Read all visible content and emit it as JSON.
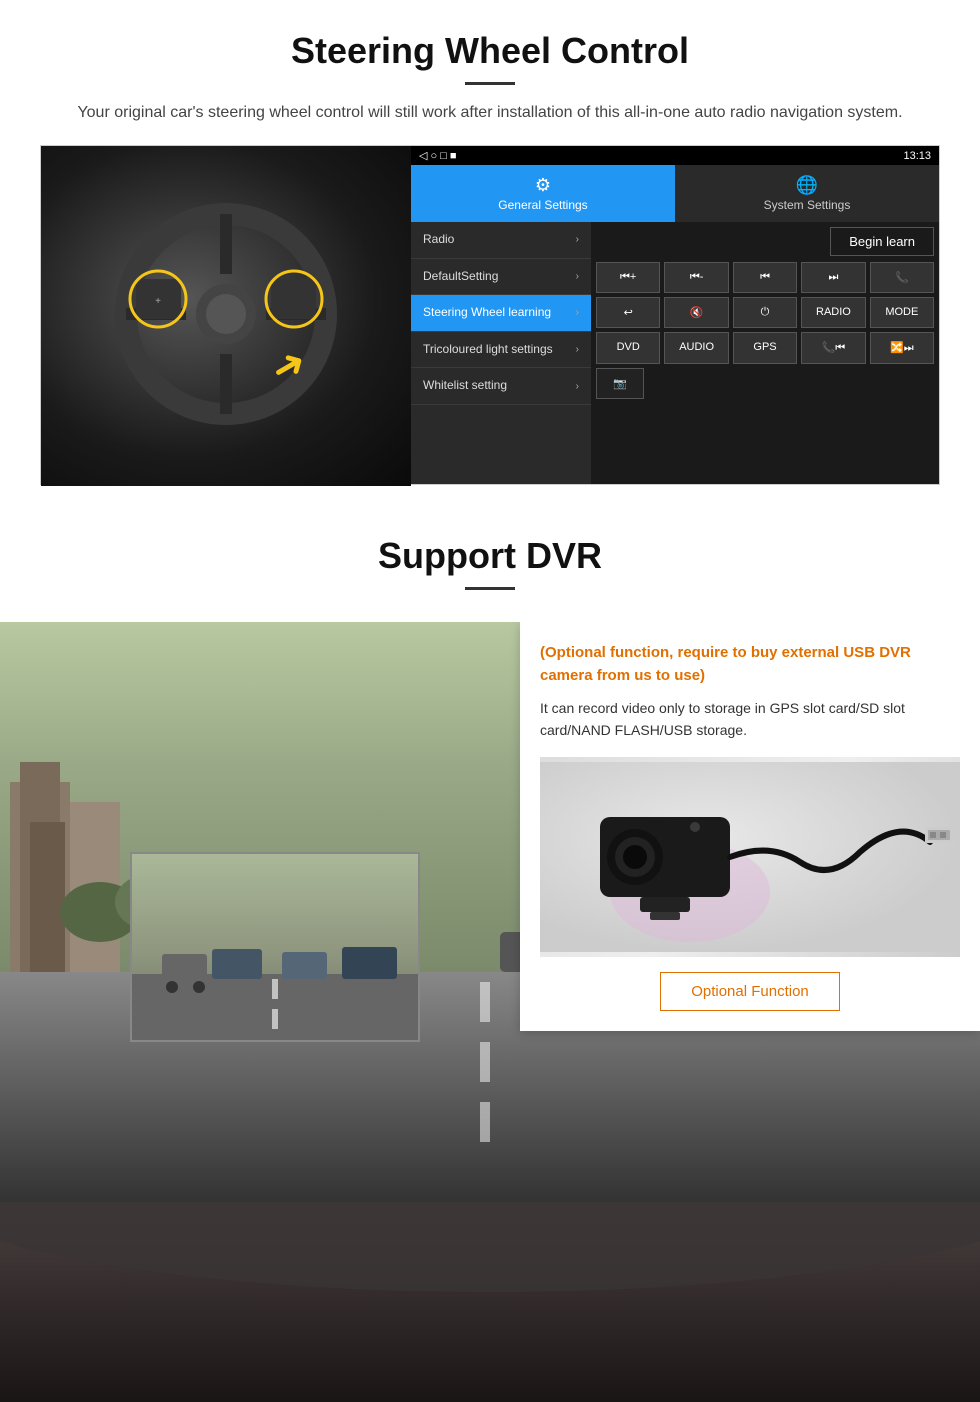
{
  "steering": {
    "title": "Steering Wheel Control",
    "subtitle": "Your original car's steering wheel control will still work after installation of this all-in-one auto radio navigation system.",
    "status_bar": {
      "time": "13:13",
      "icons": "▾ ▾"
    },
    "nav_icons": [
      "◁",
      "○",
      "□",
      "■"
    ],
    "tabs": [
      {
        "icon": "⚙",
        "label": "General Settings",
        "active": true
      },
      {
        "icon": "🌐",
        "label": "System Settings",
        "active": false
      }
    ],
    "menu_items": [
      {
        "label": "Radio",
        "active": false
      },
      {
        "label": "DefaultSetting",
        "active": false
      },
      {
        "label": "Steering Wheel learning",
        "active": true
      },
      {
        "label": "Tricoloured light settings",
        "active": false
      },
      {
        "label": "Whitelist setting",
        "active": false
      }
    ],
    "begin_learn_label": "Begin learn",
    "control_buttons_row1": [
      "⏮+",
      "⏮-",
      "⏮",
      "⏭",
      "📞"
    ],
    "control_buttons_row2": [
      "↩",
      "🔇",
      "⏻",
      "RADIO",
      "MODE"
    ],
    "control_buttons_row3": [
      "DVD",
      "AUDIO",
      "GPS",
      "📞⏮",
      "🔀⏭"
    ],
    "control_buttons_row4": [
      "📷"
    ]
  },
  "dvr": {
    "title": "Support DVR",
    "optional_text": "(Optional function, require to buy external USB DVR camera from us to use)",
    "description": "It can record video only to storage in GPS slot card/SD slot card/NAND FLASH/USB storage.",
    "optional_btn_label": "Optional Function"
  }
}
